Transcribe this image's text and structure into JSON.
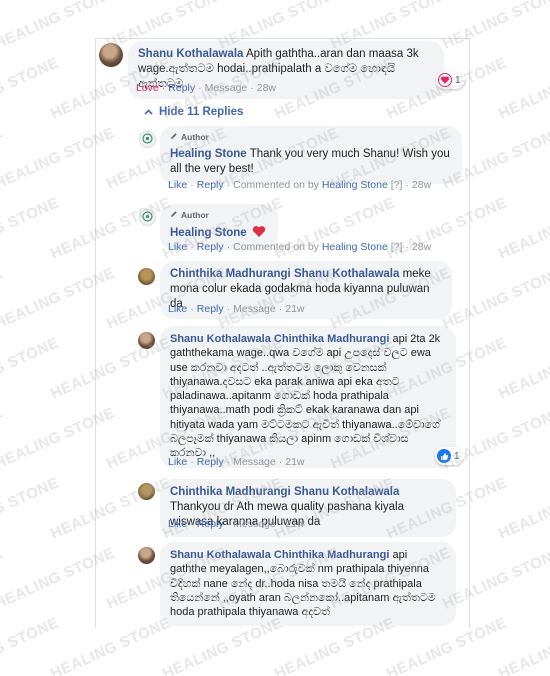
{
  "watermark_text": "HEALING STONE",
  "colors": {
    "link": "#4267b2",
    "name": "#385898",
    "bubble": "#f2f3f5",
    "love": "#e0245e",
    "like": "#1877f2"
  },
  "toggle": {
    "label": "Hide 11 Replies",
    "icon": "chevron-up-icon"
  },
  "comments": [
    {
      "author": "Shanu Kothalawala",
      "text": "Apith gaththa..aran dan maasa 3k wage.ඇත්තටම hodai..prathipalath a වගේම හොඳයි ඇත්තටම",
      "actions": [
        "Love",
        "Reply",
        "Message"
      ],
      "time": "28w",
      "reaction": {
        "icon": "heart-icon",
        "count": "1"
      }
    },
    {
      "badge": "Author",
      "author": "Healing Stone",
      "text": "Thank you very much Shanu! Wish you all the very best!",
      "actions": [
        "Like",
        "Reply"
      ],
      "commented_on_by": "Commented on by",
      "commented_by_name": "Healing Stone",
      "bracket": "[?]",
      "time": "28w"
    },
    {
      "badge": "Author",
      "author": "Healing Stone",
      "text": "",
      "emoji": "heart-icon",
      "actions": [
        "Like",
        "Reply"
      ],
      "commented_on_by": "Commented on by",
      "commented_by_name": "Healing Stone",
      "bracket": "[?]",
      "time": "28w"
    },
    {
      "author": "Chinthika Madhurangi",
      "mention": "Shanu Kothalawala",
      "text": "meke mona colur ekada godakma hoda kiyanna puluwan da",
      "actions": [
        "Like",
        "Reply",
        "Message"
      ],
      "time": "21w"
    },
    {
      "author": "Shanu Kothalawala",
      "mention": "Chinthika Madhurangi",
      "text": "api 2ta 2k gaththekama wage..qwa වගේම api උපදෙස් වලට ewa use කරනවා අදටත් ..ඇත්තටම ලොකු වෙනසක් thiyanawa.දවසට eka parak aniwa api eka අතට paladinawa..apitanm ගොඩක් hoda prathipala thiyanawa..math podi ක්‍රිකට් ekak karanawa dan api hitiyata wada yam මට්ටමකට ඇවිත් thiyanawa..මේවාගේ බලපෑමක් thiyanawa කියලා apinm ගොඩක් විශ්වාස කරනවා ,,",
      "actions": [
        "Like",
        "Reply",
        "Message"
      ],
      "time": "21w",
      "reaction": {
        "icon": "like-icon",
        "count": "1"
      }
    },
    {
      "author": "Chinthika Madhurangi",
      "mention": "Shanu Kothalawala",
      "text": "Thankyou dr Ath mewa quality pashana kiyala wiswasa karanna puluwan da",
      "actions": [
        "Like",
        "Reply",
        "Message"
      ],
      "time": "21w"
    },
    {
      "author": "Shanu Kothalawala",
      "mention": "Chinthika Madhurangi",
      "text": "api gaththe meyalagen,,බොරුවක් nm prathipala thiyenna විදිහක් nane නේද dr..hoda nisa තමයි නේද prathipala තියෙන්නේ ,,oyath aran බලන්නකෝ..apitanam ඇත්තටම hoda prathipala thiyanawa අදවත්",
      "actions": [],
      "time": ""
    }
  ]
}
